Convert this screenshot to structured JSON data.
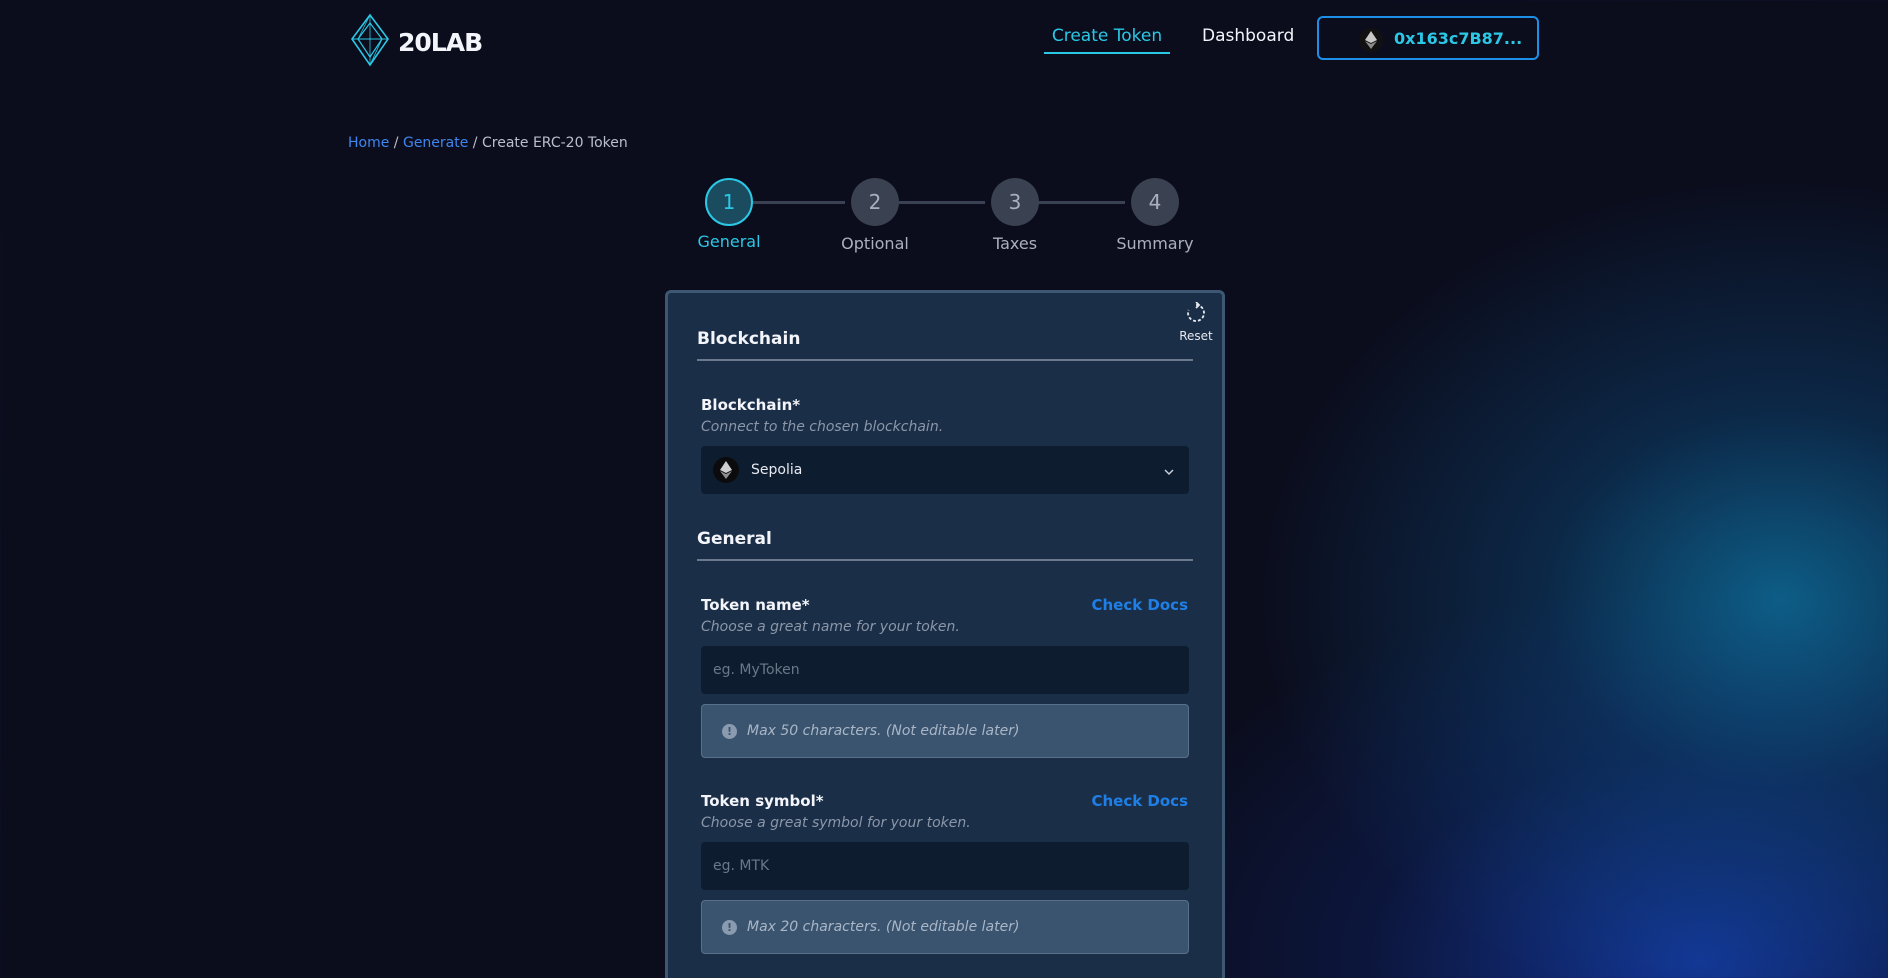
{
  "header": {
    "logo_text": "20LAB",
    "nav": {
      "create_token": "Create Token",
      "dashboard": "Dashboard"
    },
    "wallet": {
      "icon": "ethereum-icon",
      "address": "0x163c7B87..."
    }
  },
  "breadcrumb": {
    "home": "Home",
    "sep1": " / ",
    "generate": "Generate",
    "sep2": " / ",
    "current": "Create ERC-20 Token"
  },
  "stepper": {
    "active_step": 1,
    "steps": [
      {
        "number": "1",
        "label": "General"
      },
      {
        "number": "2",
        "label": "Optional"
      },
      {
        "number": "3",
        "label": "Taxes"
      },
      {
        "number": "4",
        "label": "Summary"
      }
    ]
  },
  "form": {
    "reset_label": "Reset",
    "blockchain_section": {
      "title": "Blockchain",
      "label": "Blockchain*",
      "hint": "Connect to the chosen blockchain.",
      "selected": "Sepolia",
      "selected_icon": "ethereum-icon"
    },
    "general_section": {
      "title": "General",
      "token_name": {
        "label": "Token name*",
        "hint": "Choose a great name for your token.",
        "docs": "Check Docs",
        "placeholder": "eg. MyToken",
        "value": "",
        "note": "Max 50 characters. (Not editable later)"
      },
      "token_symbol": {
        "label": "Token symbol*",
        "hint": "Choose a great symbol for your token.",
        "docs": "Check Docs",
        "placeholder": "eg. MTK",
        "value": "",
        "note": "Max 20 characters. (Not editable later)"
      }
    }
  },
  "colors": {
    "accent_cyan": "#2bc8e6",
    "link_blue": "#1f7fe6",
    "background": "#0b0d1d",
    "card": "#1a2e47"
  }
}
